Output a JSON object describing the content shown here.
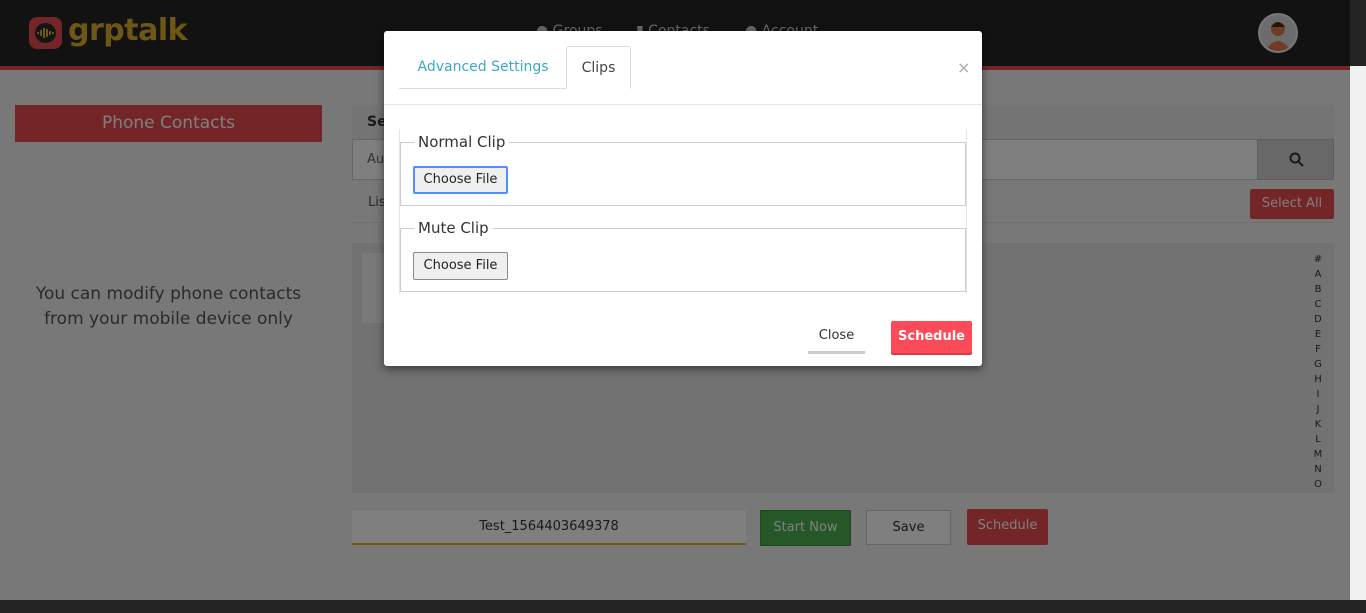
{
  "header": {
    "logo_text": "grptalk",
    "nav_items": [
      {
        "label": "Groups",
        "icon": "group-icon"
      },
      {
        "label": "Contacts",
        "icon": "contacts-book-icon"
      },
      {
        "label": "Account",
        "icon": "user-icon"
      }
    ],
    "avatar_icon": "user-avatar-icon"
  },
  "left_panel": {
    "title": "Phone Contacts",
    "message": "You can modify phone contacts from your mobile device only"
  },
  "main": {
    "search_heading": "Se",
    "search_placeholder": "Au",
    "list_label": "Lis",
    "select_all_label": "Select All",
    "alphabet": [
      "#",
      "A",
      "B",
      "C",
      "D",
      "E",
      "F",
      "G",
      "H",
      "I",
      "J",
      "K",
      "L",
      "M",
      "N",
      "O"
    ],
    "group_name_value": "Test_1564403649378",
    "start_now_label": "Start Now",
    "save_label": "Save",
    "schedule_label": "Schedule"
  },
  "modal": {
    "tabs": [
      {
        "label": "Advanced Settings",
        "active": false
      },
      {
        "label": "Clips",
        "active": true
      }
    ],
    "close_x": "×",
    "normal_clip_legend": "Normal Clip",
    "normal_clip_button": "Choose File",
    "mute_clip_legend": "Mute Clip",
    "mute_clip_button": "Choose File",
    "close_label": "Close",
    "schedule_label": "Schedule"
  },
  "colors": {
    "accent_red": "#e84b50",
    "logo_gold": "#dcae28",
    "tab_link_blue": "#3aa8c9",
    "start_green": "#4caf50"
  }
}
